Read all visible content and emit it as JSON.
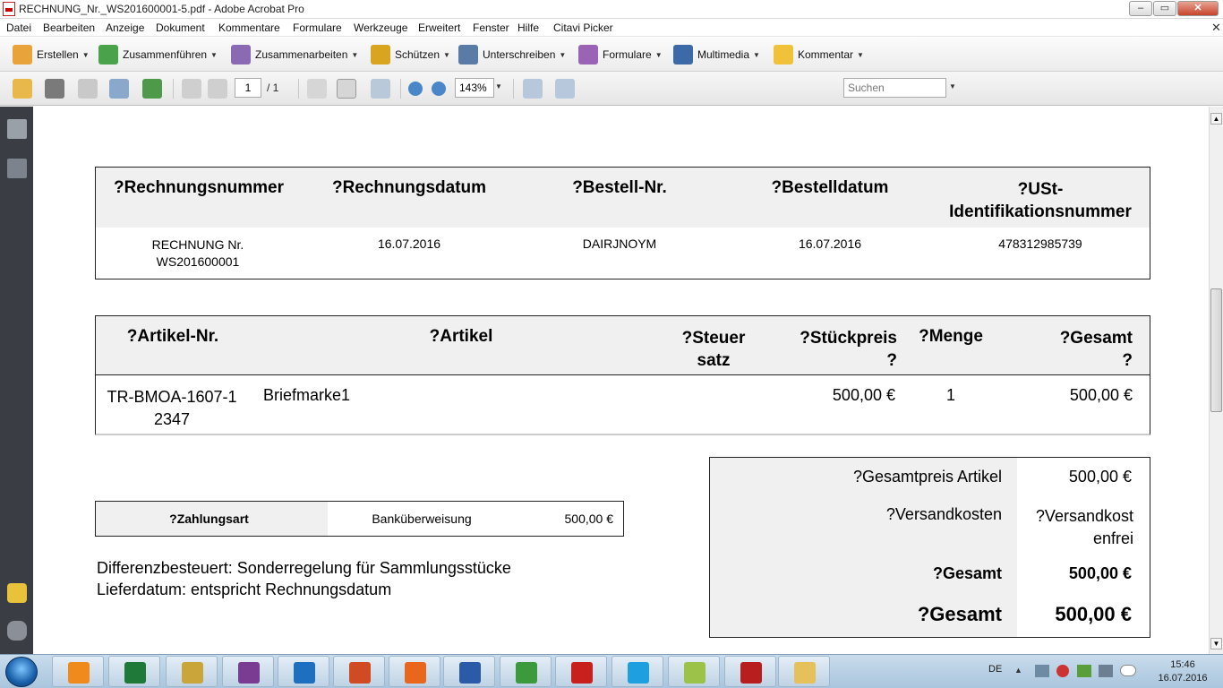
{
  "window": {
    "title": "RECHNUNG_Nr._WS201600001-5.pdf - Adobe Acrobat Pro",
    "minimize": "–",
    "maximize": "▭",
    "close": "✕"
  },
  "menu": [
    "Datei",
    "Bearbeiten",
    "Anzeige",
    "Dokument",
    "Kommentare",
    "Formulare",
    "Werkzeuge",
    "Erweitert",
    "Fenster",
    "Hilfe",
    "Citavi Picker"
  ],
  "menu_close": "✕",
  "toolbar1": [
    {
      "label": "Erstellen",
      "icon": "create-icon",
      "color": "#e8a33a"
    },
    {
      "label": "Zusammenführen",
      "icon": "combine-icon",
      "color": "#4aa34a"
    },
    {
      "label": "Zusammenarbeiten",
      "icon": "collaborate-icon",
      "color": "#8a6bb3"
    },
    {
      "label": "Schützen",
      "icon": "lock-icon",
      "color": "#d9a520"
    },
    {
      "label": "Unterschreiben",
      "icon": "pen-icon",
      "color": "#5a7ba6"
    },
    {
      "label": "Formulare",
      "icon": "forms-icon",
      "color": "#9a63b5"
    },
    {
      "label": "Multimedia",
      "icon": "multimedia-icon",
      "color": "#3c6aa8"
    },
    {
      "label": "Kommentar",
      "icon": "comment-icon",
      "color": "#f0c23a"
    }
  ],
  "toolbar2": {
    "page_current": "1",
    "page_total": "/ 1",
    "zoom": "143%",
    "search_placeholder": "Suchen"
  },
  "invoice": {
    "header_table": {
      "headers": [
        "?Rechnungsnummer",
        "?Rechnungsdatum",
        "?Bestell-Nr.",
        "?Bestelldatum",
        "?USt-\nIdentifikationsnummer"
      ],
      "values": [
        "RECHNUNG Nr.\nWS201600001",
        "16.07.2016",
        "DAIRJNOYM",
        "16.07.2016",
        "478312985739"
      ]
    },
    "item_table": {
      "headers": [
        "?Artikel-Nr.",
        "?Artikel",
        "?Steuer\nsatz",
        "?Stückpreis\n?",
        "?Menge",
        "?Gesamt\n?"
      ],
      "row": [
        "TR-BMOA-1607-1\n2347",
        "Briefmarke1",
        "",
        "500,00 €",
        "1",
        "500,00 €"
      ]
    },
    "payment": {
      "label": "?Zahlungsart",
      "method": "Banküberweisung",
      "amount": "500,00 €"
    },
    "notes": [
      "Differenzbesteuert: Sonderregelung für Sammlungsstücke",
      "Lieferdatum: entspricht Rechnungsdatum"
    ],
    "totals": [
      {
        "label": "?Gesamtpreis Artikel",
        "value": "500,00 €"
      },
      {
        "label": "?Versandkosten",
        "value": "?Versandkost\nenfrei"
      },
      {
        "label": "?Gesamt",
        "value": "500,00 €"
      },
      {
        "label": "?Gesamt",
        "value": "500,00 €"
      }
    ]
  },
  "taskbar": {
    "apps": [
      {
        "name": "media-player-icon",
        "color": "#f08a1c"
      },
      {
        "name": "excel-icon",
        "color": "#1f7a3a"
      },
      {
        "name": "fireworks-icon",
        "color": "#c9a53a"
      },
      {
        "name": "onenote-icon",
        "color": "#7a3b93"
      },
      {
        "name": "outlook-icon",
        "color": "#1f6fc0"
      },
      {
        "name": "powerpoint-icon",
        "color": "#d04a23"
      },
      {
        "name": "firefox-icon",
        "color": "#e8671c"
      },
      {
        "name": "word-icon",
        "color": "#2b5aa8"
      },
      {
        "name": "vnc-icon",
        "color": "#3c9a3c"
      },
      {
        "name": "acrobat-icon",
        "color": "#c8201c"
      },
      {
        "name": "skype-icon",
        "color": "#1ea0e0"
      },
      {
        "name": "sticky-notes-icon",
        "color": "#9cc24a"
      },
      {
        "name": "filezilla-icon",
        "color": "#b81e1e"
      },
      {
        "name": "file-explorer-icon",
        "color": "#e6c05a"
      }
    ],
    "language": "DE",
    "time": "15:46",
    "date": "16.07.2016"
  }
}
